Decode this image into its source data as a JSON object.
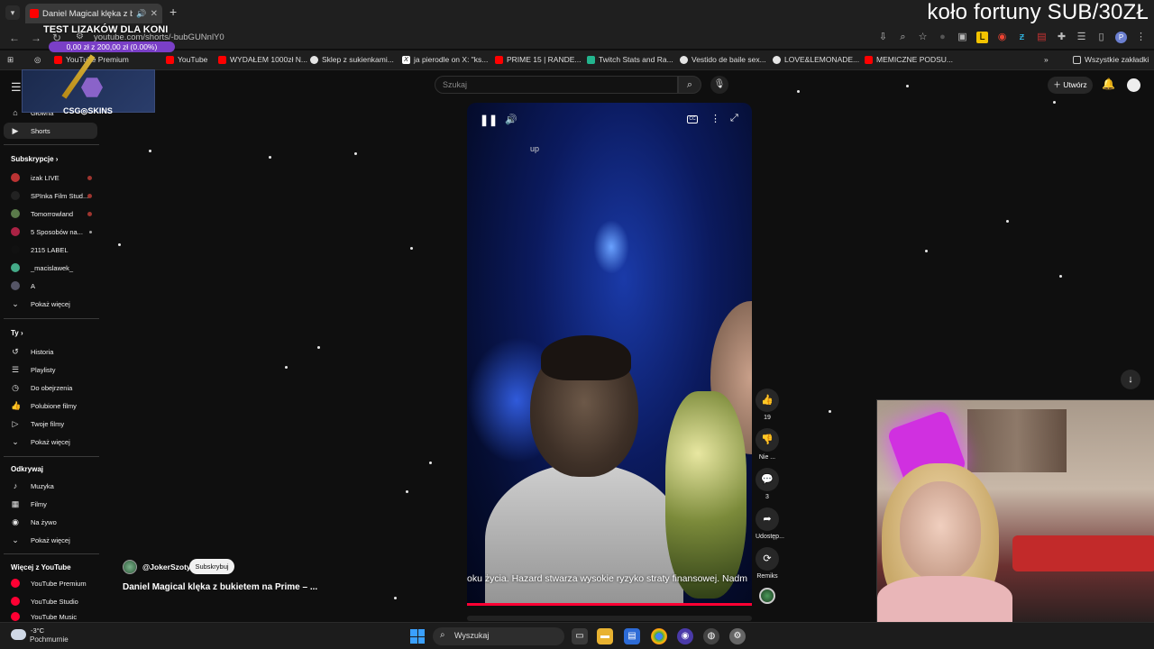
{
  "browser": {
    "tab_title": "Daniel Magical klęka z buki",
    "url": "youtube.com/shorts/-bubGUNnlY0",
    "bookmarks": [
      "YouTube Premium",
      "YouTube",
      "WYDAŁEM 1000zł N...",
      "Sklep z sukienkami...",
      "ja pierodle on X: \"ks...",
      "PRIME 15 | RANDE...",
      "Twitch Stats and Ra...",
      "Vestido de baile sex...",
      "LOVE&LEMONADE...",
      "MEMICZNE PODSU..."
    ],
    "all_bookmarks": "Wszystkie zakładki"
  },
  "stream_overlay": {
    "top_right_text": "koło fortuny SUB/30ZŁ",
    "goal_title": "TEST LIZAKÓW DLA KONI",
    "goal_progress": "0,00 zł z 200,00 zł (0.00%)",
    "goal_fraction": 0,
    "sponsor": "CSG◎SKINS"
  },
  "youtube": {
    "search_placeholder": "Szukaj",
    "create_label": "Utwórz",
    "sidebar": {
      "home": "Główna",
      "shorts": "Shorts",
      "subscriptions_header": "Subskrypcje",
      "subscriptions": [
        "izak LIVE",
        "SPInka Film Stud...",
        "Tomorrowland",
        "5 Sposobów na...",
        "2115 LABEL",
        "_macislawek_",
        "A"
      ],
      "show_more": "Pokaż więcej",
      "you_header": "Ty",
      "you_items": [
        "Historia",
        "Playlisty",
        "Do obejrzenia",
        "Polubione filmy",
        "Twoje filmy"
      ],
      "show_more_2": "Pokaż więcej",
      "explore_header": "Odkrywaj",
      "explore_items": [
        "Muzyka",
        "Filmy",
        "Na żywo"
      ],
      "show_more_3": "Pokaż więcej",
      "more_header": "Więcej z YouTube",
      "more_items": [
        "YouTube Premium",
        "YouTube Studio",
        "YouTube Music"
      ]
    },
    "video": {
      "overlay_text": "up",
      "subtitle": "oku życia. Hazard stwarza wysokie ryzyko straty finansowej. Nadm",
      "likes": "19",
      "dislike_label": "Nie ...",
      "comments": "3",
      "share_label": "Udostęp...",
      "remix_label": "Remiks"
    },
    "channel": {
      "name": "@JokerSzoty",
      "subscribe_label": "Subskrybuj"
    },
    "video_title": "Daniel Magical klęka z bukietem na Prime – ..."
  },
  "taskbar": {
    "temperature": "-3°C",
    "weather": "Pochmurnie",
    "search_placeholder": "Wyszukaj"
  }
}
